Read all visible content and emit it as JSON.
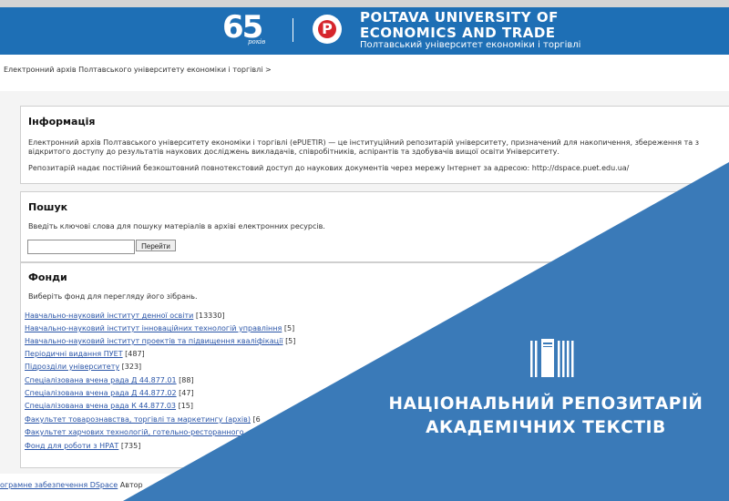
{
  "header": {
    "anniversary_number": "65",
    "anniversary_caption": "років",
    "logo_letter": "P",
    "university_name_line1": "POLTAVA UNIVERSITY OF",
    "university_name_line2": "ECONOMICS AND TRADE",
    "university_name_ua": "Полтавський університет економіки і торгівлі"
  },
  "breadcrumb": "Електронний архів Полтавського університету економіки і торгівлі >",
  "info": {
    "heading": "Інформація",
    "paragraph1_line1": "Електронний архів Полтавського університету економіки і торгівлі (ePUETIR) — це інституційний репозитарій університету, призначений для накопичення, збереження та з",
    "paragraph1_line2": "відкритого доступу до результатів наукових досліджень викладачів, співробітників, аспірантів та здобувачів вищої освіти Університету.",
    "paragraph2": "Репозитарій надає постійний безкоштовний повнотекстовий доступ до наукових документів через мережу Інтернет за адресою: http://dspace.puet.edu.ua/"
  },
  "search": {
    "heading": "Пошук",
    "prompt": "Введіть ключові слова для пошуку матеріалів в архіві електронних ресурсів.",
    "input_value": "",
    "button_label": "Перейти"
  },
  "funds": {
    "heading": "Фонди",
    "prompt": "Виберіть фонд для перегляду його зібрань.",
    "items": [
      {
        "label": "Навчально-науковий інститут денної освіти",
        "count": "[13330]"
      },
      {
        "label": "Навчально-науковий інститут інноваційних технологій управління",
        "count": "[5]"
      },
      {
        "label": "Навчально-науковий інститут проектів та підвищення кваліфікації",
        "count": "[5]"
      },
      {
        "label": "Періодичні видання ПУЕТ",
        "count": "[487]"
      },
      {
        "label": "Підрозділи університету",
        "count": "[323]"
      },
      {
        "label": "Спеціалізована вчена рада Д 44.877.01",
        "count": "[88]"
      },
      {
        "label": "Спеціалізована вчена рада Д 44.877.02",
        "count": "[47]"
      },
      {
        "label": "Спеціалізована вчена рада К 44.877.03",
        "count": "[15]"
      },
      {
        "label": "Факультет товарознавства, торгівлі та маркетингу (архів)",
        "count": "[6"
      },
      {
        "label": "Факультет харчових технологій, готельно-ресторанного",
        "count": ""
      },
      {
        "label": "Фонд для роботи з НРАТ",
        "count": "[735]"
      }
    ]
  },
  "footer": {
    "link_text": "ограмне забезпечення DSpace",
    "trailing_text": "Автор"
  },
  "banner": {
    "title_line1": "НАЦІОНАЛЬНИЙ РЕПОЗИТАРІЙ",
    "title_line2": "АКАДЕМІЧНИХ ТЕКСТІВ",
    "icon": "books-icon"
  },
  "colors": {
    "header_blue": "#1e6fb5",
    "banner_blue": "#3a7ab8",
    "link_blue": "#2a55a8",
    "logo_red": "#d6262d"
  }
}
